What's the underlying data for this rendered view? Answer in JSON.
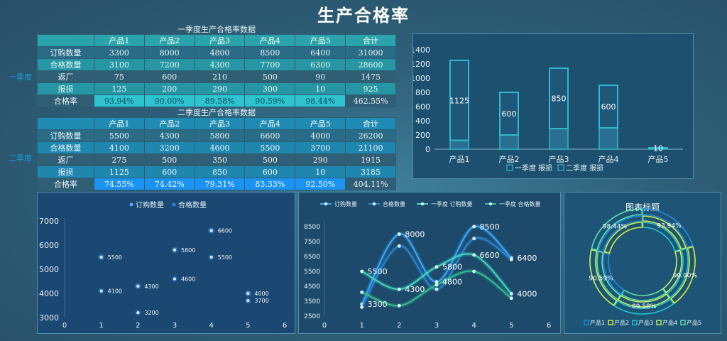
{
  "title": "生产合格率",
  "q1": {
    "label": "一季度",
    "table_title": "一季度生产合格率数据",
    "header": [
      "",
      "产品1",
      "产品2",
      "产品3",
      "产品4",
      "产品5",
      "合计"
    ],
    "rows": [
      [
        "订购数量",
        "3300",
        "8000",
        "4800",
        "8500",
        "6400",
        "31000"
      ],
      [
        "合格数量",
        "3100",
        "7200",
        "4300",
        "7700",
        "6300",
        "28600"
      ],
      [
        "返厂",
        "75",
        "600",
        "210",
        "500",
        "90",
        "1475"
      ],
      [
        "报损",
        "125",
        "200",
        "290",
        "300",
        "10",
        "925"
      ]
    ],
    "rate": [
      "合格率",
      "93.94%",
      "90.00%",
      "89.58%",
      "90.59%",
      "98.44%",
      "462.55%"
    ]
  },
  "q2": {
    "label": "二季度",
    "table_title": "二季度生产合格率数据",
    "header": [
      "",
      "产品1",
      "产品2",
      "产品3",
      "产品4",
      "产品5",
      "合计"
    ],
    "rows": [
      [
        "订购数量",
        "5500",
        "4300",
        "5800",
        "6600",
        "4000",
        "26200"
      ],
      [
        "合格数量",
        "4100",
        "3200",
        "4600",
        "5500",
        "3700",
        "21100"
      ],
      [
        "返厂",
        "275",
        "500",
        "350",
        "500",
        "290",
        "1915"
      ],
      [
        "报损",
        "1125",
        "600",
        "850",
        "600",
        "10",
        "3185"
      ]
    ],
    "rate": [
      "合格率",
      "74.55%",
      "74.42%",
      "79.31%",
      "83.33%",
      "92.50%",
      "404.11%"
    ]
  },
  "colors": {
    "q1_line": "#39a8ff",
    "q2_line": "#3fd9c1",
    "bar": "#31b8c9",
    "donut_blue": "#1c8ee8",
    "donut_yellow": "#d8f03a",
    "donut_cyan": "#22c8d8"
  },
  "chart_data": [
    {
      "type": "bar",
      "categories": [
        "产品1",
        "产品2",
        "产品3",
        "产品4",
        "产品5"
      ],
      "series": [
        {
          "name": "一季度 报损",
          "values": [
            125,
            200,
            290,
            300,
            10
          ]
        },
        {
          "name": "二季度 报损",
          "values": [
            1125,
            600,
            850,
            600,
            10
          ]
        }
      ],
      "stacked": true,
      "data_labels": [
        "1125",
        "600",
        "850",
        "600",
        "10"
      ],
      "ylim": [
        0,
        1400
      ],
      "yticks": [
        0,
        200,
        400,
        600,
        800,
        1000,
        1200,
        1400
      ],
      "legend": "bottom"
    },
    {
      "type": "scatter",
      "series": [
        {
          "name": "订购数量",
          "points": [
            [
              1,
              5500
            ],
            [
              2,
              4300
            ],
            [
              3,
              5800
            ],
            [
              4,
              6600
            ],
            [
              5,
              4000
            ]
          ]
        },
        {
          "name": "合格数量",
          "points": [
            [
              1,
              4100
            ],
            [
              2,
              3200
            ],
            [
              3,
              4600
            ],
            [
              4,
              5500
            ],
            [
              5,
              3700
            ]
          ]
        }
      ],
      "xlim": [
        0,
        6
      ],
      "xticks": [
        0,
        1,
        2,
        3,
        4,
        5,
        6
      ],
      "ylim": [
        3000,
        7000
      ],
      "yticks": [
        3000,
        4000,
        5000,
        6000,
        7000
      ],
      "legend": "top"
    },
    {
      "type": "line",
      "series": [
        {
          "name": "订购数量",
          "points": [
            [
              1,
              3300
            ],
            [
              2,
              8000
            ],
            [
              3,
              4800
            ],
            [
              4,
              8500
            ],
            [
              5,
              6400
            ]
          ]
        },
        {
          "name": "合格数量",
          "points": [
            [
              1,
              3100
            ],
            [
              2,
              7200
            ],
            [
              3,
              4300
            ],
            [
              4,
              7700
            ],
            [
              5,
              6300
            ]
          ]
        },
        {
          "name": "一季度 订购数量",
          "points": [
            [
              1,
              5500
            ],
            [
              2,
              4300
            ],
            [
              3,
              5800
            ],
            [
              4,
              6600
            ],
            [
              5,
              4000
            ]
          ]
        },
        {
          "name": "一季度 合格数量",
          "points": [
            [
              1,
              4100
            ],
            [
              2,
              3200
            ],
            [
              3,
              4600
            ],
            [
              4,
              5500
            ],
            [
              5,
              3700
            ]
          ]
        }
      ],
      "data_labels": [
        {
          "x": 1,
          "y": 3300,
          "text": "3300"
        },
        {
          "x": 2,
          "y": 8000,
          "text": "8000"
        },
        {
          "x": 3,
          "y": 4800,
          "text": "4800"
        },
        {
          "x": 4,
          "y": 8500,
          "text": "8500"
        },
        {
          "x": 5,
          "y": 6400,
          "text": "6400"
        },
        {
          "x": 1,
          "y": 5500,
          "text": "5500"
        },
        {
          "x": 2,
          "y": 4300,
          "text": "4300"
        },
        {
          "x": 3,
          "y": 5800,
          "text": "5800"
        },
        {
          "x": 4,
          "y": 6600,
          "text": "6600"
        },
        {
          "x": 5,
          "y": 4000,
          "text": "4000"
        }
      ],
      "xlim": [
        0,
        6
      ],
      "xticks": [
        0,
        1,
        2,
        3,
        4,
        5,
        6
      ],
      "ylim": [
        2500,
        8500
      ],
      "yticks": [
        2500,
        3500,
        4500,
        5500,
        6500,
        7500,
        8500
      ],
      "legend": "top"
    },
    {
      "type": "pie",
      "variant": "donut",
      "title": "图表标题",
      "labels": [
        "产品1",
        "产品2",
        "产品3",
        "产品4",
        "产品5"
      ],
      "values": [
        93.94,
        90.0,
        89.58,
        90.59,
        98.44
      ],
      "data_labels": [
        "93.94%",
        "90.00%",
        "89.58%",
        "90.59%",
        "98.44%"
      ],
      "legend": "bottom"
    }
  ]
}
